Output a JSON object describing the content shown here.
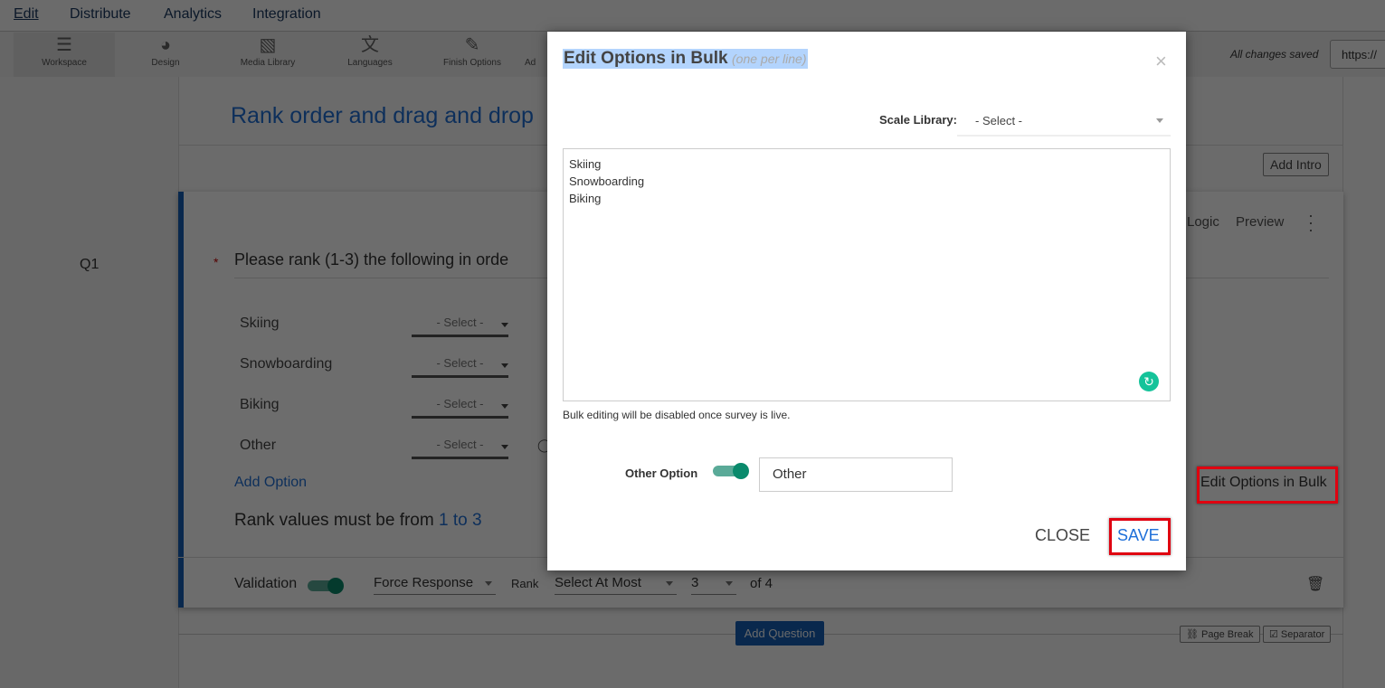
{
  "nav": {
    "tabs": [
      "Edit",
      "Distribute",
      "Analytics",
      "Integration"
    ]
  },
  "toolbar": {
    "items": [
      {
        "label": "Workspace",
        "icon": "workspace-icon"
      },
      {
        "label": "Design",
        "icon": "palette-icon"
      },
      {
        "label": "Media Library",
        "icon": "image-icon"
      },
      {
        "label": "Languages",
        "icon": "translate-icon"
      },
      {
        "label": "Finish Options",
        "icon": "magic-wand-icon"
      },
      {
        "label": "Ad"
      }
    ],
    "status": "All changes saved",
    "url": "https://"
  },
  "survey": {
    "title": "Rank order and drag and drop",
    "add_intro": "Add Intro",
    "question_number": "Q1",
    "required_mark": "*",
    "question_text": "Please rank (1-3) the following in orde",
    "actions": {
      "logic": "Logic",
      "preview": "Preview"
    },
    "options": [
      {
        "label": "Skiing",
        "select": "- Select -"
      },
      {
        "label": "Snowboarding",
        "select": "- Select -"
      },
      {
        "label": "Biking",
        "select": "- Select -"
      },
      {
        "label": "Other",
        "select": "- Select -"
      }
    ],
    "add_option": "Add Option",
    "edit_bulk": "Edit Options in Bulk",
    "rank_note_prefix": "Rank values must be from ",
    "rank_note_range": "1 to 3",
    "validation": {
      "label": "Validation",
      "enabled": true,
      "force_response": "Force Response",
      "rank_label": "Rank",
      "select_at_most": "Select At Most",
      "count": "3",
      "of": "of 4"
    },
    "add_question": "Add Question",
    "page_break": "Page Break",
    "separator": "Separator"
  },
  "modal": {
    "title": "Edit Options in Bulk",
    "subtitle": "(one per line)",
    "close_x": "×",
    "scale_label": "Scale Library:",
    "scale_value": "- Select -",
    "textarea": "Skiing\nSnowboarding\nBiking",
    "note": "Bulk editing will be disabled once survey is live.",
    "other_label": "Other Option",
    "other_enabled": true,
    "other_value": "Other",
    "close": "CLOSE",
    "save": "SAVE"
  },
  "colors": {
    "accent": "#1e6fd9",
    "highlight": "#e00010",
    "toggle": "#0a8a6c"
  }
}
